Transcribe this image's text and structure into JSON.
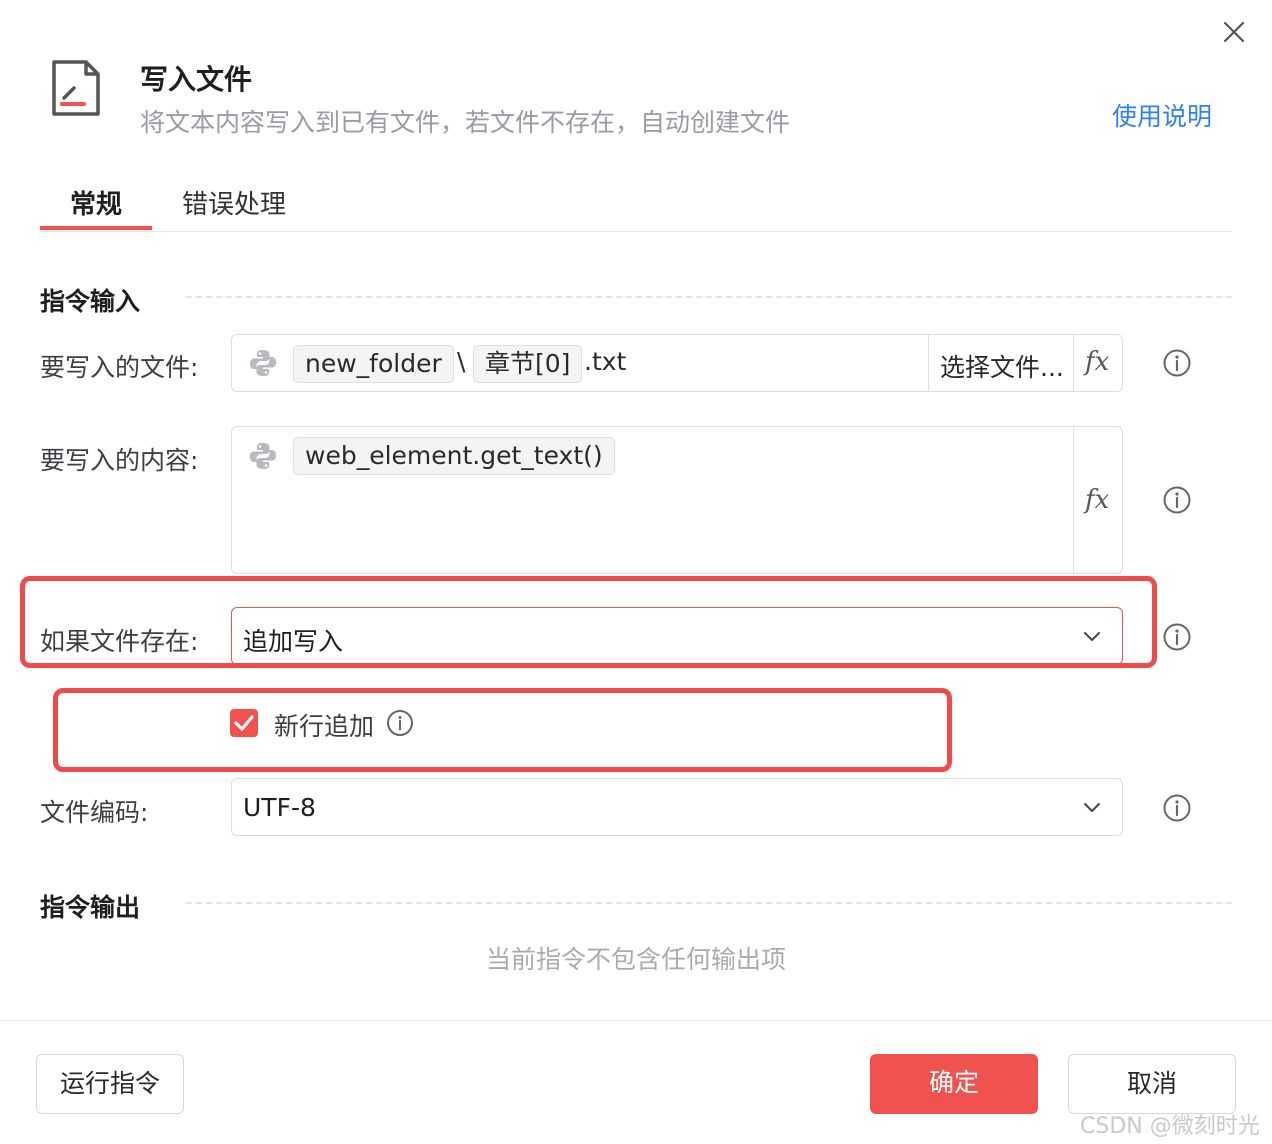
{
  "header": {
    "title": "写入文件",
    "subtitle": "将文本内容写入到已有文件，若文件不存在，自动创建文件",
    "help_link": "使用说明"
  },
  "tabs": [
    {
      "label": "常规",
      "active": true
    },
    {
      "label": "错误处理",
      "active": false
    }
  ],
  "sections": {
    "input": "指令输入",
    "output": "指令输出"
  },
  "fields": {
    "file": {
      "label": "要写入的文件:",
      "chip1": "new_folder",
      "separator": "\\",
      "chip2": "章节[0]",
      "suffix": ".txt",
      "choose_button": "选择文件...",
      "fx": "fx"
    },
    "content": {
      "label": "要写入的内容:",
      "chip": "web_element.get_text()",
      "fx": "fx"
    },
    "if_exists": {
      "label": "如果文件存在:",
      "value": "追加写入"
    },
    "newline_append": {
      "label": "新行追加",
      "checked": true
    },
    "encoding": {
      "label": "文件编码:",
      "value": "UTF-8"
    }
  },
  "output": {
    "empty_text": "当前指令不包含任何输出项"
  },
  "footer": {
    "run_label": "运行指令",
    "ok_label": "确定",
    "cancel_label": "取消"
  },
  "watermark": "CSDN @微刻时光",
  "colors": {
    "accent": "#f0524f",
    "link": "#2f7ff5",
    "highlight": "#ee4b4b"
  },
  "icons": [
    "close-icon",
    "file-edit-icon",
    "python-icon",
    "info-icon",
    "chevron-down-icon",
    "checkmark-icon"
  ]
}
